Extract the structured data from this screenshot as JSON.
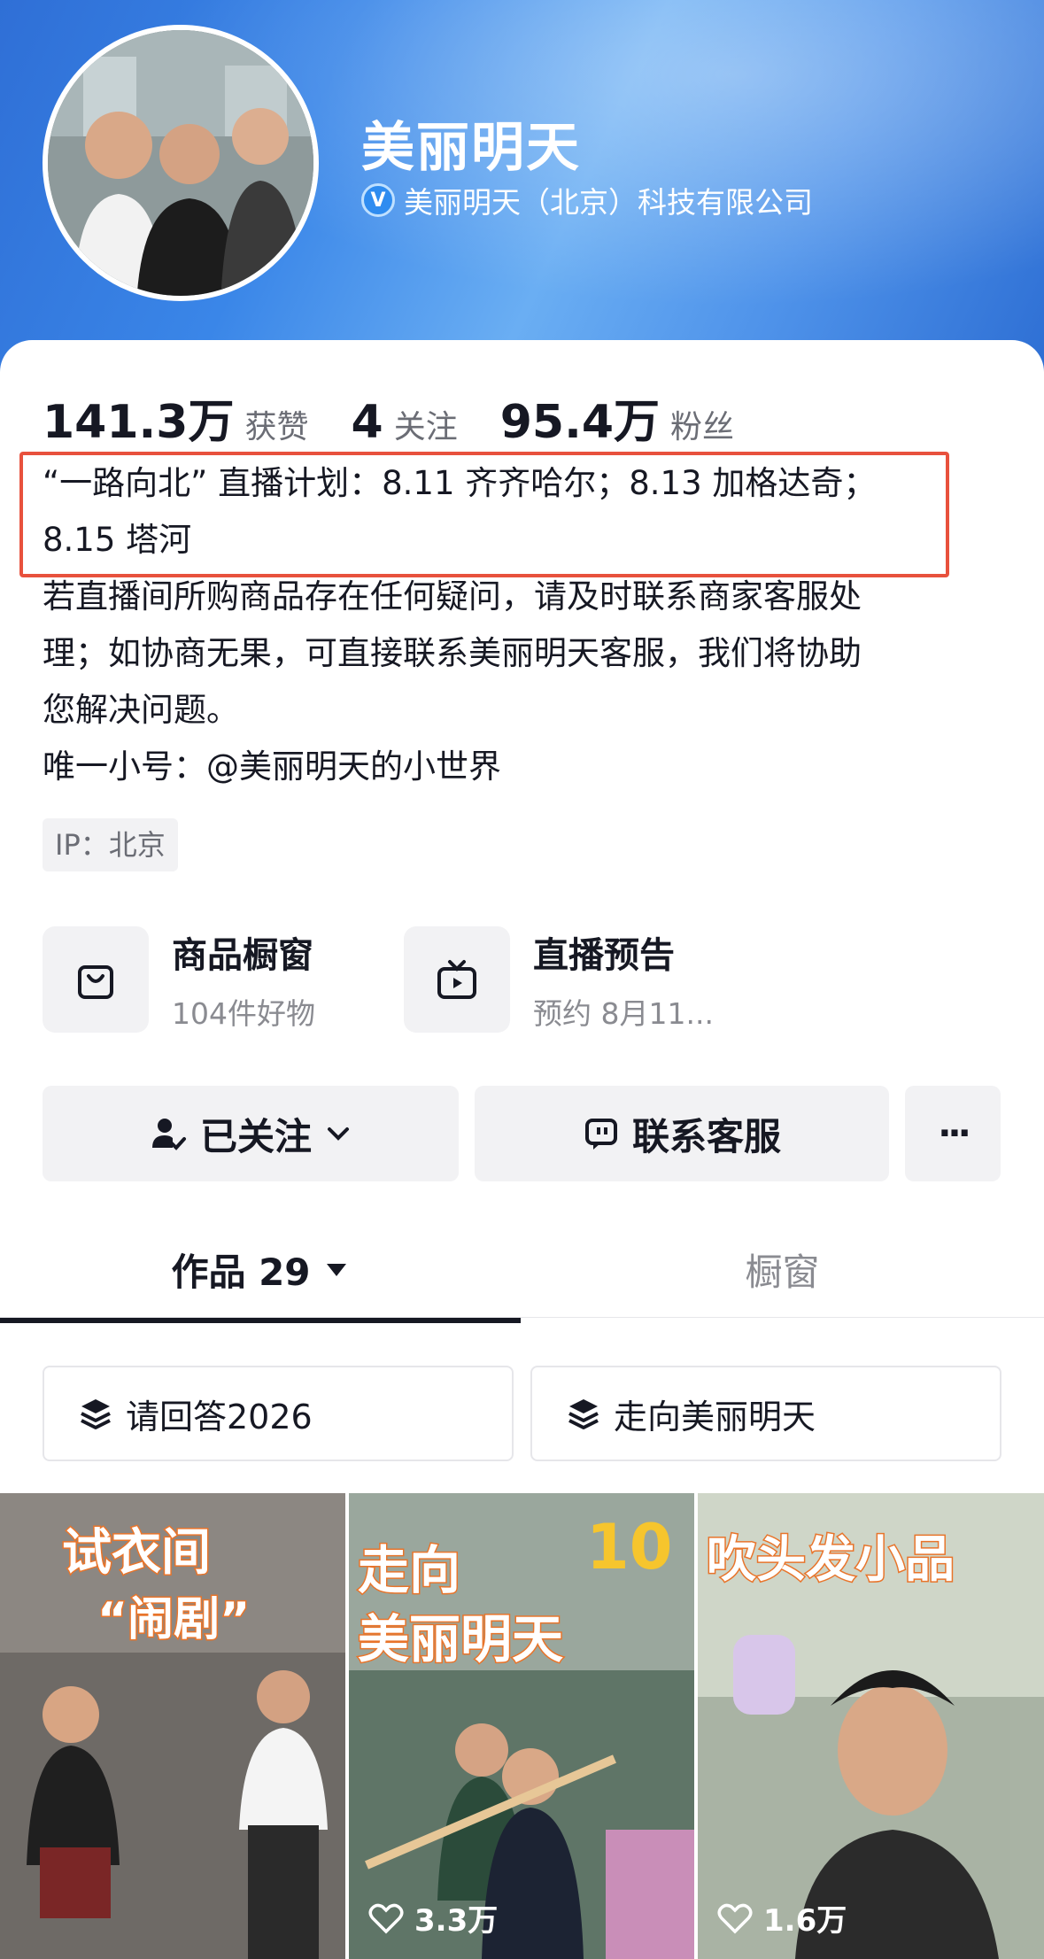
{
  "header": {
    "name": "美丽明天",
    "company": "美丽明天（北京）科技有限公司"
  },
  "stats": [
    {
      "value": "141.3万",
      "label": "获赞"
    },
    {
      "value": "4",
      "label": "关注"
    },
    {
      "value": "95.4万",
      "label": "粉丝"
    }
  ],
  "bio": {
    "line1": "“一路向北” 直播计划：8.11 齐齐哈尔；8.13 加格达奇；",
    "line2": "8.15 塔河",
    "line3": "若直播间所购商品存在任何疑问，请及时联系商家客服处",
    "line4": "理；如协商无果，可直接联系美丽明天客服，我们将协助",
    "line5": "您解决问题。",
    "line6": "唯一小号：@美丽明天的小世界"
  },
  "ip": "IP：北京",
  "shortcuts": [
    {
      "title": "商品橱窗",
      "subtitle": "104件好物"
    },
    {
      "title": "直播预告",
      "subtitle": "预约 8月11..."
    }
  ],
  "buttons": {
    "follow": "已关注",
    "contact": "联系客服",
    "more": "···"
  },
  "tabs": {
    "works": "作品 29",
    "showcase": "橱窗"
  },
  "collections": [
    "请回答2026",
    "走向美丽明天"
  ],
  "videos": [
    {
      "title_line1": "试衣间",
      "title_line2": "“闹剧”",
      "likes": ""
    },
    {
      "title_line1": "走向",
      "title_line2": "美丽明天",
      "badge": "10",
      "likes": "3.3万"
    },
    {
      "title_line1": "吹头发小品",
      "likes": "1.6万"
    }
  ],
  "colors": {
    "accent_blue": "#2f6fd6",
    "highlight_red": "#e8513d",
    "thumb_title_orange": "#e8742a"
  }
}
